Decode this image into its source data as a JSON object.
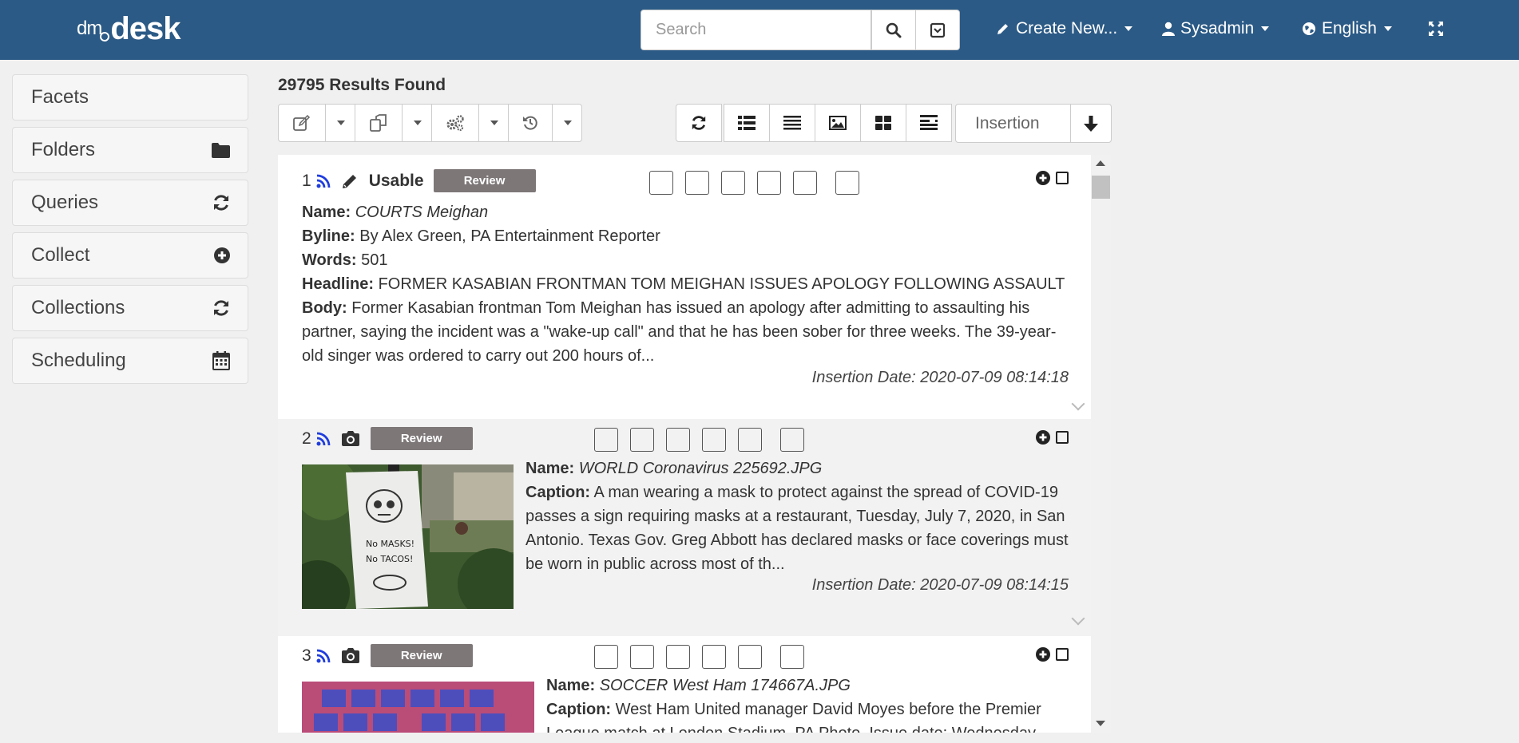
{
  "app": {
    "logo_dm": "dm",
    "logo_desk": "desk"
  },
  "navbar": {
    "search_placeholder": "Search",
    "create_new": "Create New...",
    "user": "Sysadmin",
    "language": "English"
  },
  "sidebar": {
    "items": [
      {
        "label": "Facets",
        "icon": "none"
      },
      {
        "label": "Folders",
        "icon": "folder-icon"
      },
      {
        "label": "Queries",
        "icon": "refresh-icon"
      },
      {
        "label": "Collect",
        "icon": "plus-circle-icon"
      },
      {
        "label": "Collections",
        "icon": "refresh-icon"
      },
      {
        "label": "Scheduling",
        "icon": "calendar-icon"
      }
    ]
  },
  "results": {
    "count_label": "29795 Results Found",
    "sort_field": "Insertion",
    "items": [
      {
        "num": "1",
        "status": "Usable",
        "badge": "Review",
        "type_icon": "pencil-icon",
        "name_label": "Name:",
        "name": "COURTS Meighan",
        "byline_label": "Byline:",
        "byline": "By Alex Green, PA Entertainment Reporter",
        "words_label": "Words:",
        "words": "501",
        "headline_label": "Headline:",
        "headline": "FORMER KASABIAN FRONTMAN TOM MEIGHAN ISSUES APOLOGY FOLLOWING ASSAULT",
        "body_label": "Body:",
        "body": "Former Kasabian frontman Tom Meighan has issued an apology after admitting to assaulting his partner, saying the incident was a \"wake-up call\" and that he has been sober for three weeks. The 39-year-old singer was ordered to carry out 200 hours of...",
        "insertion": "Insertion Date: 2020-07-09 08:14:18"
      },
      {
        "num": "2",
        "badge": "Review",
        "type_icon": "camera-icon",
        "name_label": "Name:",
        "name": "WORLD Coronavirus 225692.JPG",
        "caption_label": "Caption:",
        "caption": "A man wearing a mask to protect against the spread of COVID-19 passes a sign requiring masks at a restaurant, Tuesday, July 7, 2020, in San Antonio. Texas Gov. Greg Abbott has declared masks or face coverings must be worn in public across most of th...",
        "insertion": "Insertion Date: 2020-07-09 08:14:15",
        "thumb_text_1": "No MASKS!",
        "thumb_text_2": "No TACOS!"
      },
      {
        "num": "3",
        "badge": "Review",
        "type_icon": "camera-icon",
        "name_label": "Name:",
        "name": "SOCCER West Ham 174667A.JPG",
        "caption_label": "Caption:",
        "caption": "West Ham United manager David Moyes before the Premier League match at London Stadium. PA Photo. Issue date: Wednesday..."
      }
    ]
  }
}
